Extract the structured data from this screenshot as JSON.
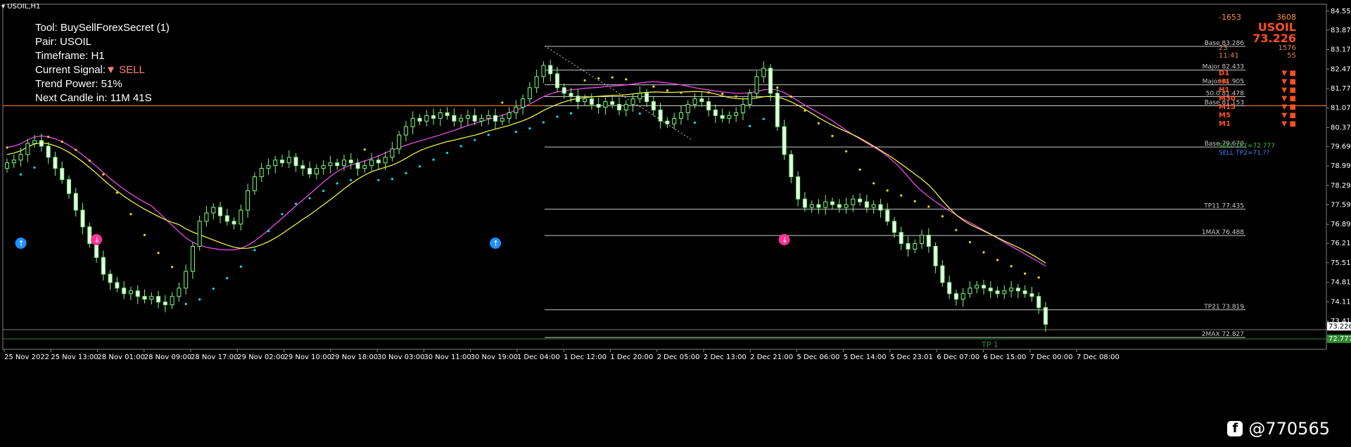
{
  "window": {
    "title": "USOIL,H1"
  },
  "info": {
    "tool": "Tool: BuySellForexSecret (1)",
    "pair": "Pair: USOIL",
    "timeframe": "Timeframe: H1",
    "signal_label": "Current Signal:",
    "signal_value": "SELL",
    "trend_power": "Trend Power: 51%",
    "next_candle": "Next Candle in: 11M 41S"
  },
  "panel": {
    "pips_left": "-1653",
    "pips_right": "3608",
    "symbol": "USOIL",
    "price": "73.226",
    "row3_left": "23",
    "row3_right": "1576",
    "row4_left": "11:41",
    "row4_right": "55",
    "timeframes": [
      "D1",
      "H4",
      "H1",
      "M30",
      "M15",
      "M5",
      "M1"
    ],
    "sell_tp1": "SELL TP1=72.777",
    "sell_tp2": "SELL TP2=71.??"
  },
  "y_axis": {
    "ticks": [
      "84.550",
      "83.870",
      "83.170",
      "82.470",
      "81.770",
      "81.070",
      "80.370",
      "79.690",
      "78.990",
      "78.290",
      "77.590",
      "76.890",
      "76.210",
      "75.510",
      "74.810",
      "74.110",
      "73.410",
      "72.727"
    ],
    "current_price": "73.226",
    "tp_price": "72.777"
  },
  "x_axis": {
    "ticks": [
      "25 Nov 2022",
      "25 Nov 13:00",
      "28 Nov 01:00",
      "28 Nov 09:00",
      "28 Nov 17:00",
      "29 Nov 02:00",
      "29 Nov 10:00",
      "29 Nov 18:00",
      "30 Nov 03:00",
      "30 Nov 11:00",
      "30 Nov 19:00",
      "1 Dec 04:00",
      "1 Dec 12:00",
      "1 Dec 20:00",
      "2 Dec 05:00",
      "2 Dec 13:00",
      "2 Dec 21:00",
      "5 Dec 06:00",
      "5 Dec 14:00",
      "5 Dec 23:01",
      "6 Dec 07:00",
      "6 Dec 15:00",
      "7 Dec 00:00",
      "7 Dec 08:00"
    ]
  },
  "levels": [
    {
      "label": "Base 83.286",
      "price": 83.286
    },
    {
      "label": "Major 82.433",
      "price": 82.433
    },
    {
      "label": "Major 81.905",
      "price": 81.905
    },
    {
      "label": "50.0 81.478",
      "price": 81.478
    },
    {
      "label": "Base 81.153",
      "price": 81.153
    },
    {
      "label": "Base 79.670",
      "price": 79.67
    },
    {
      "label": "TP11 77.435",
      "price": 77.435
    },
    {
      "label": "1MAX 76.488",
      "price": 76.488
    },
    {
      "label": "TP21 73.819",
      "price": 73.819
    },
    {
      "label": "2MAX 72.827",
      "price": 72.827
    }
  ],
  "tp_label": "TP 1",
  "watermark": {
    "icon": "facebook-icon",
    "handle": "@770565"
  },
  "colors": {
    "bull": "#7cfc7c",
    "bear": "#e8ffe8",
    "ma_fast": "#ff4cff",
    "ma_slow": "#ffff40",
    "dots_up": "#00e5ff",
    "dots_down": "#ffd700",
    "horizontal": "#ff8c00"
  },
  "chart_data": {
    "type": "candlestick",
    "symbol": "USOIL",
    "timeframe": "H1",
    "ylim": [
      72.4,
      84.8
    ],
    "close_series": [
      79.1,
      79.2,
      79.4,
      79.8,
      79.9,
      79.7,
      79.3,
      78.9,
      78.5,
      78.0,
      77.4,
      76.8,
      76.2,
      75.7,
      75.1,
      74.8,
      74.6,
      74.4,
      74.5,
      74.3,
      74.2,
      74.3,
      74.1,
      74.0,
      74.3,
      74.6,
      75.2,
      76.1,
      77.0,
      77.3,
      77.5,
      77.2,
      77.0,
      76.9,
      77.4,
      78.1,
      78.6,
      78.9,
      79.0,
      79.2,
      79.1,
      79.3,
      79.0,
      78.9,
      78.7,
      78.9,
      79.0,
      79.1,
      79.0,
      79.2,
      79.1,
      78.9,
      79.0,
      79.2,
      79.1,
      79.3,
      79.6,
      80.1,
      80.4,
      80.7,
      80.6,
      80.8,
      80.7,
      80.9,
      80.8,
      80.6,
      80.7,
      80.8,
      80.6,
      80.7,
      80.8,
      80.6,
      80.7,
      80.9,
      81.1,
      81.4,
      81.8,
      82.2,
      82.6,
      82.3,
      81.8,
      81.6,
      81.5,
      81.3,
      81.4,
      81.2,
      81.1,
      81.3,
      81.2,
      81.0,
      81.2,
      81.4,
      81.6,
      81.3,
      81.0,
      80.6,
      80.5,
      80.7,
      80.9,
      81.2,
      81.4,
      81.3,
      81.0,
      80.8,
      80.7,
      80.8,
      80.9,
      81.2,
      81.6,
      82.2,
      82.5,
      81.6,
      80.4,
      79.4,
      78.6,
      77.8,
      77.5,
      77.6,
      77.5,
      77.7,
      77.6,
      77.5,
      77.6,
      77.8,
      77.7,
      77.5,
      77.6,
      77.4,
      77.0,
      76.6,
      76.2,
      76.0,
      76.2,
      76.5,
      76.1,
      75.4,
      74.8,
      74.4,
      74.2,
      74.4,
      74.6,
      74.7,
      74.6,
      74.5,
      74.4,
      74.5,
      74.6,
      74.5,
      74.4,
      74.3,
      73.9,
      73.3
    ]
  }
}
